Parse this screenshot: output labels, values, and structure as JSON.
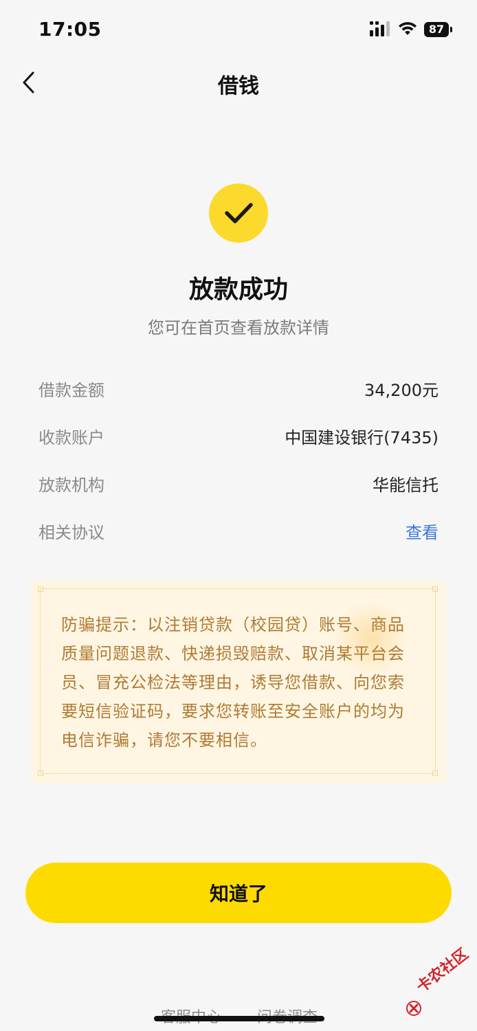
{
  "status_bar": {
    "time": "17:05",
    "battery": "87"
  },
  "nav": {
    "title": "借钱"
  },
  "result": {
    "title": "放款成功",
    "subtitle": "您可在首页查看放款详情"
  },
  "details": [
    {
      "label": "借款金额",
      "value": "34,200元"
    },
    {
      "label": "收款账户",
      "value": "中国建设银行(7435)"
    },
    {
      "label": "放款机构",
      "value": "华能信托"
    },
    {
      "label": "相关协议",
      "value": "查看"
    }
  ],
  "notice": {
    "text": "防骗提示：以注销贷款（校园贷）账号、商品质量问题退款、快递损毁赔款、取消某平台会员、冒充公检法等理由，诱导您借款、向您索要短信验证码，要求您转账至安全账户的均为电信诈骗，请您不要相信。"
  },
  "actions": {
    "confirm_label": "知道了"
  },
  "footer": {
    "service_label": "客服中心",
    "survey_label": "问卷调查"
  },
  "watermark": {
    "text": "卡农社区"
  },
  "colors": {
    "accent": "#fedb00",
    "link": "#3c78d8",
    "notice_text": "#b07a34",
    "notice_bg": "#fef6e3"
  }
}
